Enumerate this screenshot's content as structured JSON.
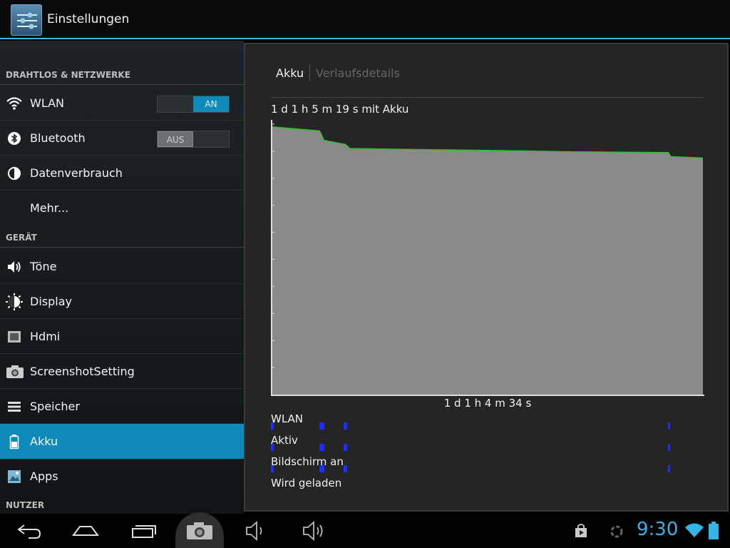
{
  "app": {
    "title": "Einstellungen",
    "icon": "settings-sliders-icon"
  },
  "sidebar": {
    "sections": [
      {
        "header": "DRAHTLOS & NETZWERKE"
      },
      {
        "header": "GERÄT"
      },
      {
        "header": "NUTZER"
      }
    ],
    "items": [
      {
        "label": "WLAN",
        "icon": "wifi-icon",
        "toggle": "AN"
      },
      {
        "label": "Bluetooth",
        "icon": "bluetooth-icon",
        "toggle": "AUS"
      },
      {
        "label": "Datenverbrauch",
        "icon": "data-usage-icon"
      },
      {
        "label": "Mehr...",
        "icon": ""
      },
      {
        "label": "Töne",
        "icon": "speaker-icon"
      },
      {
        "label": "Display",
        "icon": "display-icon"
      },
      {
        "label": "Hdmi",
        "icon": "hdmi-icon"
      },
      {
        "label": "ScreenshotSetting",
        "icon": "camera-icon"
      },
      {
        "label": "Speicher",
        "icon": "storage-icon"
      },
      {
        "label": "Akku",
        "icon": "battery-icon",
        "selected": true
      },
      {
        "label": "Apps",
        "icon": "apps-icon"
      }
    ]
  },
  "main": {
    "tabs": [
      {
        "label": "Akku",
        "active": true
      },
      {
        "label": "Verlaufsdetails",
        "active": false
      }
    ],
    "battery_duration": "1 d 1 h 5 m 19 s mit Akku",
    "graph_time_label": "1 d 1 h 4 m 34 s",
    "tracks": [
      {
        "label": "WLAN"
      },
      {
        "label": "Aktiv"
      },
      {
        "label": "Bildschirm an"
      },
      {
        "label": "Wird geladen"
      }
    ]
  },
  "chart_data": {
    "type": "area",
    "title": "",
    "xlabel": "1 d 1 h 4 m 34 s",
    "ylabel": "",
    "ylim": [
      0,
      100
    ],
    "series": [
      {
        "x_fraction": [
          0,
          0.11,
          0.12,
          0.17,
          0.18,
          0.3,
          0.5,
          0.7,
          0.92,
          0.925,
          1.0
        ],
        "values": [
          99,
          97.5,
          94,
          92.5,
          91,
          90.7,
          90.3,
          89.8,
          89.5,
          88,
          87.5
        ]
      }
    ],
    "fill_color": "#8a8a8a",
    "line_color": "#2fbf2f",
    "grid": false
  },
  "status_bar": {
    "time": "9:30",
    "accent_color": "#33b5e5",
    "icons": [
      "back-icon",
      "home-icon",
      "recent-apps-icon",
      "screenshot-icon",
      "volume-down-icon",
      "volume-up-icon",
      "store-icon",
      "sync-icon",
      "wifi-status-icon",
      "battery-status-icon"
    ]
  }
}
